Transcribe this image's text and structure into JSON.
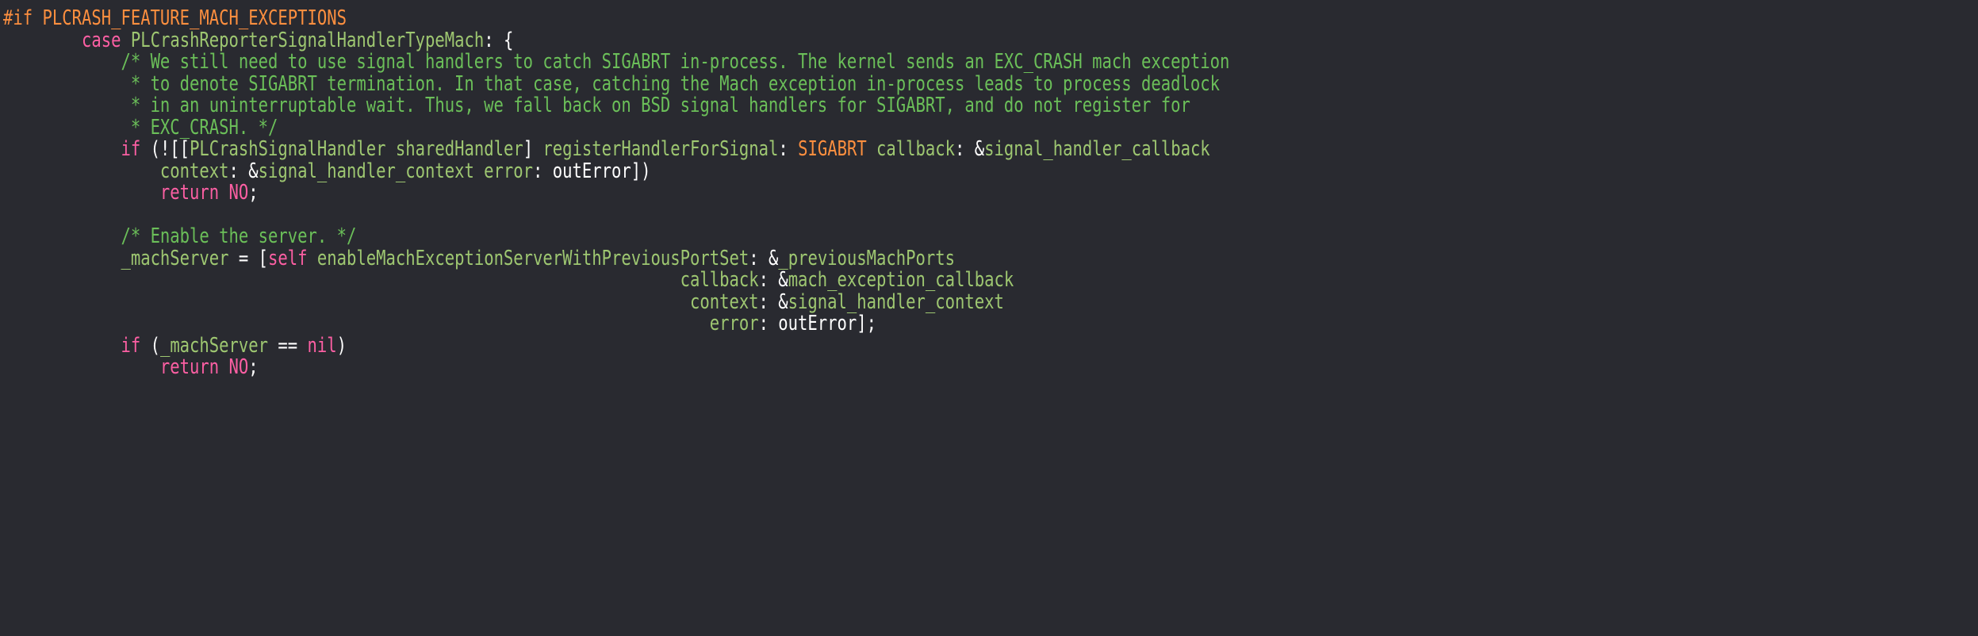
{
  "colors": {
    "background": "#292a30",
    "plain": "#ffffff",
    "keyword": "#fc5fa3",
    "comment": "#6bbf59",
    "macro": "#fd8f3f",
    "identifier": "#9ec771"
  },
  "code_lines": [
    {
      "indent": "",
      "tokens": [
        {
          "t": "#if PLCRASH_FEATURE_MACH_EXCEPTIONS",
          "k": "macro"
        }
      ]
    },
    {
      "indent": "        ",
      "tokens": [
        {
          "t": "case ",
          "k": "keyword"
        },
        {
          "t": "PLCrashReporterSignalHandlerTypeMach",
          "k": "type"
        },
        {
          "t": ": {",
          "k": "plain"
        }
      ]
    },
    {
      "indent": "            ",
      "tokens": [
        {
          "t": "/* We still need to use signal handlers to catch SIGABRT in-process. The kernel sends an EXC_CRASH mach exception",
          "k": "comment"
        }
      ]
    },
    {
      "indent": "            ",
      "tokens": [
        {
          "t": " * to denote SIGABRT termination. In that case, catching the Mach exception in-process leads to process deadlock",
          "k": "comment"
        }
      ]
    },
    {
      "indent": "            ",
      "tokens": [
        {
          "t": " * in an uninterruptable wait. Thus, we fall back on BSD signal handlers for SIGABRT, and do not register for",
          "k": "comment"
        }
      ]
    },
    {
      "indent": "            ",
      "tokens": [
        {
          "t": " * EXC_CRASH. */",
          "k": "comment"
        }
      ]
    },
    {
      "indent": "            ",
      "tokens": [
        {
          "t": "if",
          "k": "keyword"
        },
        {
          "t": " (![[",
          "k": "plain"
        },
        {
          "t": "PLCrashSignalHandler",
          "k": "type"
        },
        {
          "t": " ",
          "k": "plain"
        },
        {
          "t": "sharedHandler",
          "k": "func"
        },
        {
          "t": "] ",
          "k": "plain"
        },
        {
          "t": "registerHandlerForSignal",
          "k": "func"
        },
        {
          "t": ": ",
          "k": "plain"
        },
        {
          "t": "SIGABRT",
          "k": "macro"
        },
        {
          "t": " ",
          "k": "plain"
        },
        {
          "t": "callback",
          "k": "func"
        },
        {
          "t": ": &",
          "k": "plain"
        },
        {
          "t": "signal_handler_callback",
          "k": "func"
        }
      ]
    },
    {
      "indent": "                ",
      "tokens": [
        {
          "t": "context",
          "k": "func"
        },
        {
          "t": ": &",
          "k": "plain"
        },
        {
          "t": "signal_handler_context",
          "k": "func"
        },
        {
          "t": " ",
          "k": "plain"
        },
        {
          "t": "error",
          "k": "func"
        },
        {
          "t": ": outError])",
          "k": "plain"
        }
      ]
    },
    {
      "indent": "                ",
      "tokens": [
        {
          "t": "return NO",
          "k": "keyword"
        },
        {
          "t": ";",
          "k": "plain"
        }
      ]
    },
    {
      "indent": "",
      "tokens": []
    },
    {
      "indent": "            ",
      "tokens": [
        {
          "t": "/* Enable the server. */",
          "k": "comment"
        }
      ]
    },
    {
      "indent": "            ",
      "tokens": [
        {
          "t": "_machServer",
          "k": "func"
        },
        {
          "t": " = [",
          "k": "plain"
        },
        {
          "t": "self",
          "k": "keyword"
        },
        {
          "t": " ",
          "k": "plain"
        },
        {
          "t": "enableMachExceptionServerWithPreviousPortSet",
          "k": "func"
        },
        {
          "t": ": &",
          "k": "plain"
        },
        {
          "t": "_previousMachPorts",
          "k": "func"
        }
      ]
    },
    {
      "indent": "                                                                     ",
      "tokens": [
        {
          "t": "callback",
          "k": "func"
        },
        {
          "t": ": &",
          "k": "plain"
        },
        {
          "t": "mach_exception_callback",
          "k": "func"
        }
      ]
    },
    {
      "indent": "                                                                      ",
      "tokens": [
        {
          "t": "context",
          "k": "func"
        },
        {
          "t": ": &",
          "k": "plain"
        },
        {
          "t": "signal_handler_context",
          "k": "func"
        }
      ]
    },
    {
      "indent": "                                                                        ",
      "tokens": [
        {
          "t": "error",
          "k": "func"
        },
        {
          "t": ": outError];",
          "k": "plain"
        }
      ]
    },
    {
      "indent": "            ",
      "tokens": [
        {
          "t": "if",
          "k": "keyword"
        },
        {
          "t": " (",
          "k": "plain"
        },
        {
          "t": "_machServer",
          "k": "func"
        },
        {
          "t": " == ",
          "k": "plain"
        },
        {
          "t": "nil",
          "k": "keyword"
        },
        {
          "t": ")",
          "k": "plain"
        }
      ]
    },
    {
      "indent": "                ",
      "tokens": [
        {
          "t": "return NO",
          "k": "keyword"
        },
        {
          "t": ";",
          "k": "plain"
        }
      ]
    }
  ]
}
